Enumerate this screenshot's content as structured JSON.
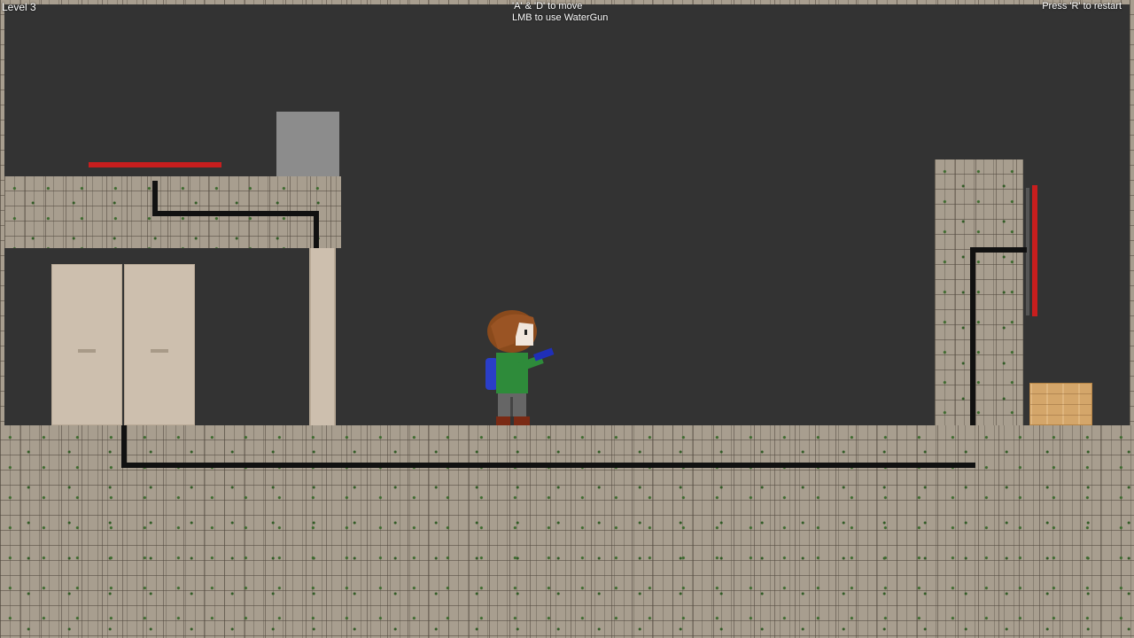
{
  "hud": {
    "level": "Level 3",
    "controls_line1": "'A' & 'D' to move",
    "controls_line2": "LMB to use WaterGun",
    "restart": "Press 'R' to restart"
  },
  "colors": {
    "background": "#333333",
    "stone": "#a89e8f",
    "laser": "#c81e1e",
    "wire": "#111111",
    "crate": "#d4a66a",
    "door": "#cdbfae",
    "block": "#8c8c8c"
  },
  "icons": {
    "player": "player-character-with-watergun",
    "door": "double-door-icon",
    "crate": "wooden-crate-icon"
  }
}
